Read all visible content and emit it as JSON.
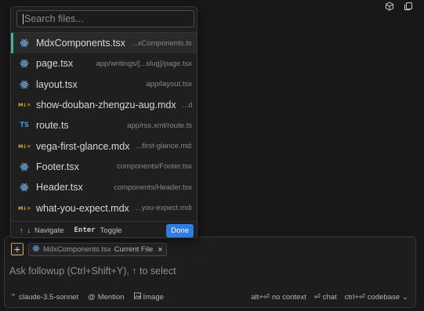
{
  "top_icons": [
    "cube-icon",
    "copy-icon"
  ],
  "picker": {
    "search_placeholder": "Search files...",
    "files": [
      {
        "icon": "react-icon",
        "name": "MdxComponents.tsx",
        "path": "...xComponents.tsx",
        "selected": true
      },
      {
        "icon": "react-icon",
        "name": "page.tsx",
        "path": "app/writings/[...slug]/page.tsx"
      },
      {
        "icon": "react-icon",
        "name": "layout.tsx",
        "path": "app/layout.tsx"
      },
      {
        "icon": "mdx-icon",
        "name": "show-douban-zhengzu-aug.mdx",
        "path": "...dx"
      },
      {
        "icon": "ts-icon",
        "name": "route.ts",
        "path": "app/rss.xml/route.ts"
      },
      {
        "icon": "mdx-icon",
        "name": "vega-first-glance.mdx",
        "path": "...first-glance.mdx"
      },
      {
        "icon": "react-icon",
        "name": "Footer.tsx",
        "path": "components/Footer.tsx"
      },
      {
        "icon": "react-icon",
        "name": "Header.tsx",
        "path": "components/Header.tsx"
      },
      {
        "icon": "mdx-icon",
        "name": "what-you-expect.mdx",
        "path": "...you-expect.mdx"
      }
    ],
    "icon_text": {
      "ts": "TS",
      "mdx": "M↓✕"
    },
    "footer": {
      "up_key": "↑",
      "down_key": "↓",
      "navigate_label": "Navigate",
      "enter_key": "Enter",
      "toggle_label": "Toggle",
      "done_label": "Done"
    }
  },
  "composer": {
    "add_label": "+",
    "chip": {
      "name": "MdxComponents.tsx",
      "tag": "Current File",
      "close": "×"
    },
    "placeholder": "Ask followup (Ctrl+Shift+Y), ↑ to select",
    "bottom": {
      "model_chevron": "⌃",
      "model": "claude-3.5-sonnet",
      "mention_symbol": "@",
      "mention": "Mention",
      "image": "Image",
      "no_context_keys": "alt+⏎",
      "no_context": "no context",
      "chat_keys": "⏎",
      "chat": "chat",
      "codebase_keys": "ctrl+⏎",
      "codebase": "codebase",
      "codebase_chevron": "⌄"
    }
  },
  "colors": {
    "background": "#181818",
    "accent_green": "#3cb49a",
    "done_blue": "#2f7ee0",
    "react_blue": "#6fa8dc",
    "ts_blue": "#4a8fd6",
    "mdx_orange": "#e3a23a"
  }
}
